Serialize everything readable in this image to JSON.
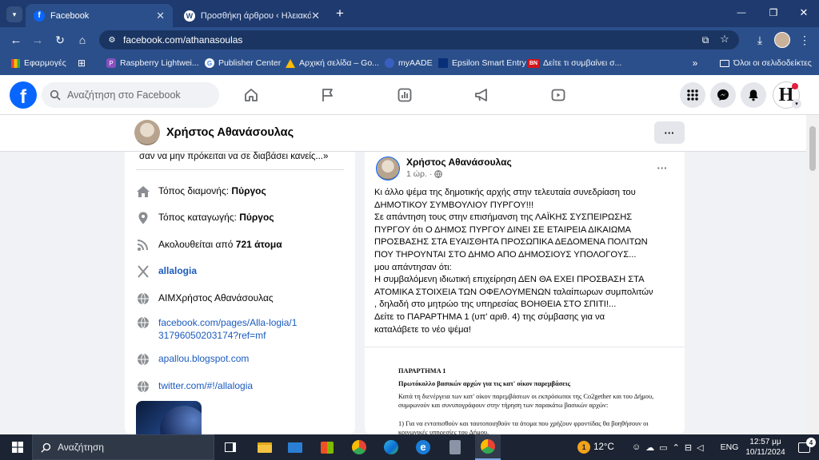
{
  "browser": {
    "tabs": [
      {
        "title": "Facebook",
        "active": true
      },
      {
        "title": "Προσθήκη άρθρου ‹ Ηλειακά Ν",
        "active": false
      }
    ],
    "new_tab": "+",
    "url": "facebook.com/athanasoulas",
    "bookmarks": [
      "Εφαρμογές",
      "Raspberry Lightwei...",
      "Publisher Center",
      "Αρχική σελίδα – Go...",
      "myAADE",
      "Epsilon Smart Entry",
      "Δείτε τι συμβαίνει σ..."
    ],
    "bookmarks_more": "»",
    "all_bookmarks": "Όλοι οι σελιδοδείκτες",
    "window_controls": {
      "minimize": "—",
      "maximize": "❐",
      "close": "✕"
    }
  },
  "facebook": {
    "search_placeholder": "Αναζήτηση στο Facebook",
    "profile_name": "Χρήστος Αθανάσουλας",
    "more_button": "···",
    "intro": {
      "quote_tail": "σαν να μην πρόκειται να σε διαβάσει κανείς...»",
      "rows": [
        {
          "icon": "home-icon",
          "prefix": "Τόπος διαμονής: ",
          "bold": "Πύργος"
        },
        {
          "icon": "location-pin-icon",
          "prefix": "Τόπος καταγωγής: ",
          "bold": "Πύργος"
        },
        {
          "icon": "rss-icon",
          "prefix": "Ακολουθείται από ",
          "bold": "721 άτομα"
        },
        {
          "icon": "x-logo-icon",
          "link": "allalogia"
        },
        {
          "icon": "globe-icon",
          "text": "AIMΧρήστος Αθανάσουλας"
        },
        {
          "icon": "globe-icon",
          "link": "facebook.com/pages/Alla-logia/131796050203174?ref=mf"
        },
        {
          "icon": "globe-icon",
          "link": "apallou.blogspot.com"
        },
        {
          "icon": "globe-icon",
          "link": "twitter.com/#!/allalogia"
        }
      ]
    },
    "post": {
      "author": "Χρήστος Αθανάσουλας",
      "time": "1 ώρ.",
      "separator": "·",
      "more": "···",
      "text": "Κι άλλο ψέμα της δημοτικής αρχής στην τελευταία συνεδρίαση του\nΔΗΜΟΤΙΚΟΥ ΣΥΜΒΟΥΛΙΟΥ ΠΥΡΓΟΥ!!!\nΣε απάντηση τους στην επισήμανση της ΛΑΪΚΗΣ ΣΥΣΠΕΙΡΩΣΗΣ\nΠΥΡΓΟΥ ότι Ο ΔΗΜΟΣ ΠΥΡΓΟΥ ΔΙΝΕΙ ΣΕ ΕΤΑΙΡΕΙΑ ΔΙΚΑΙΩΜΑ\nΠΡΟΣΒΑΣΗΣ  ΣΤΑ ΕΥΑΙΣΘΗΤΑ ΠΡΟΣΩΠΙΚΑ ΔΕΔΟΜΕΝΑ ΠΟΛΙΤΩΝ\nΠΟΥ ΤΗΡΟΥΝΤΑΙ ΣΤΟ ΔΗΜΟ ΑΠΟ ΔΗΜΟΣΙΟΥΣ ΥΠΟΛΟΓΟΥΣ...\nμου απάντησαν ότι:\nΗ συμβαλόμενη ιδιωτική επιχείρηση ΔΕΝ ΘΑ ΕΧΕΙ ΠΡΟΣΒΑΣΗ ΣΤΑ\nΑΤΟΜΙΚΑ ΣΤΟΙΧΕΙΑ ΤΩΝ ΟΦΕΛΟΥΜΕΝΩΝ ταλαίπωρων συμπολιτών\n, δηλαδή στο μητρώο της υπηρεσίας ΒΟΗΘΕΙΑ ΣΤΟ ΣΠΙΤΙ!...\nΔείτε το ΠΑΡΑΡΤΗΜΑ 1 (υπ' αριθ. 4) της σύμβασης για να\nκαταλάβετε το νέο ψέμα!",
      "doc": {
        "heading": "ΠΑΡΑΡΤΗΜΑ 1",
        "subheading": "Πρωτόκολλο βασικών αρχών για τις κατ' οίκον παρεμβάσεις",
        "p1": "Κατά τη διενέργεια των κατ' οίκον παρεμβάσεων οι εκπρόσωποι  της Co2gether και του Δήμου, συμφωνούν και συνυπογράφουν στην τήρηση των παρακάτω βασικών αρχών:",
        "p2": "1) Για να εντοπισθούν και ταυτοποιηθούν τα άτομα που χρήζουν φροντίδας θα βοηθήσουν οι κοινωνικές υπηρεσίες του Δήμου."
      }
    }
  },
  "taskbar": {
    "search_placeholder": "Αναζήτηση",
    "temperature": "12°C",
    "weather_badge": "1",
    "language": "ENG",
    "time": "12:57 μμ",
    "date": "10/11/2024",
    "notification_count": "4"
  },
  "colors": {
    "fb_blue": "#0866ff",
    "chrome_dark": "#1e3a6e",
    "chrome": "#2b4f8a",
    "link": "#1b5bbf"
  }
}
